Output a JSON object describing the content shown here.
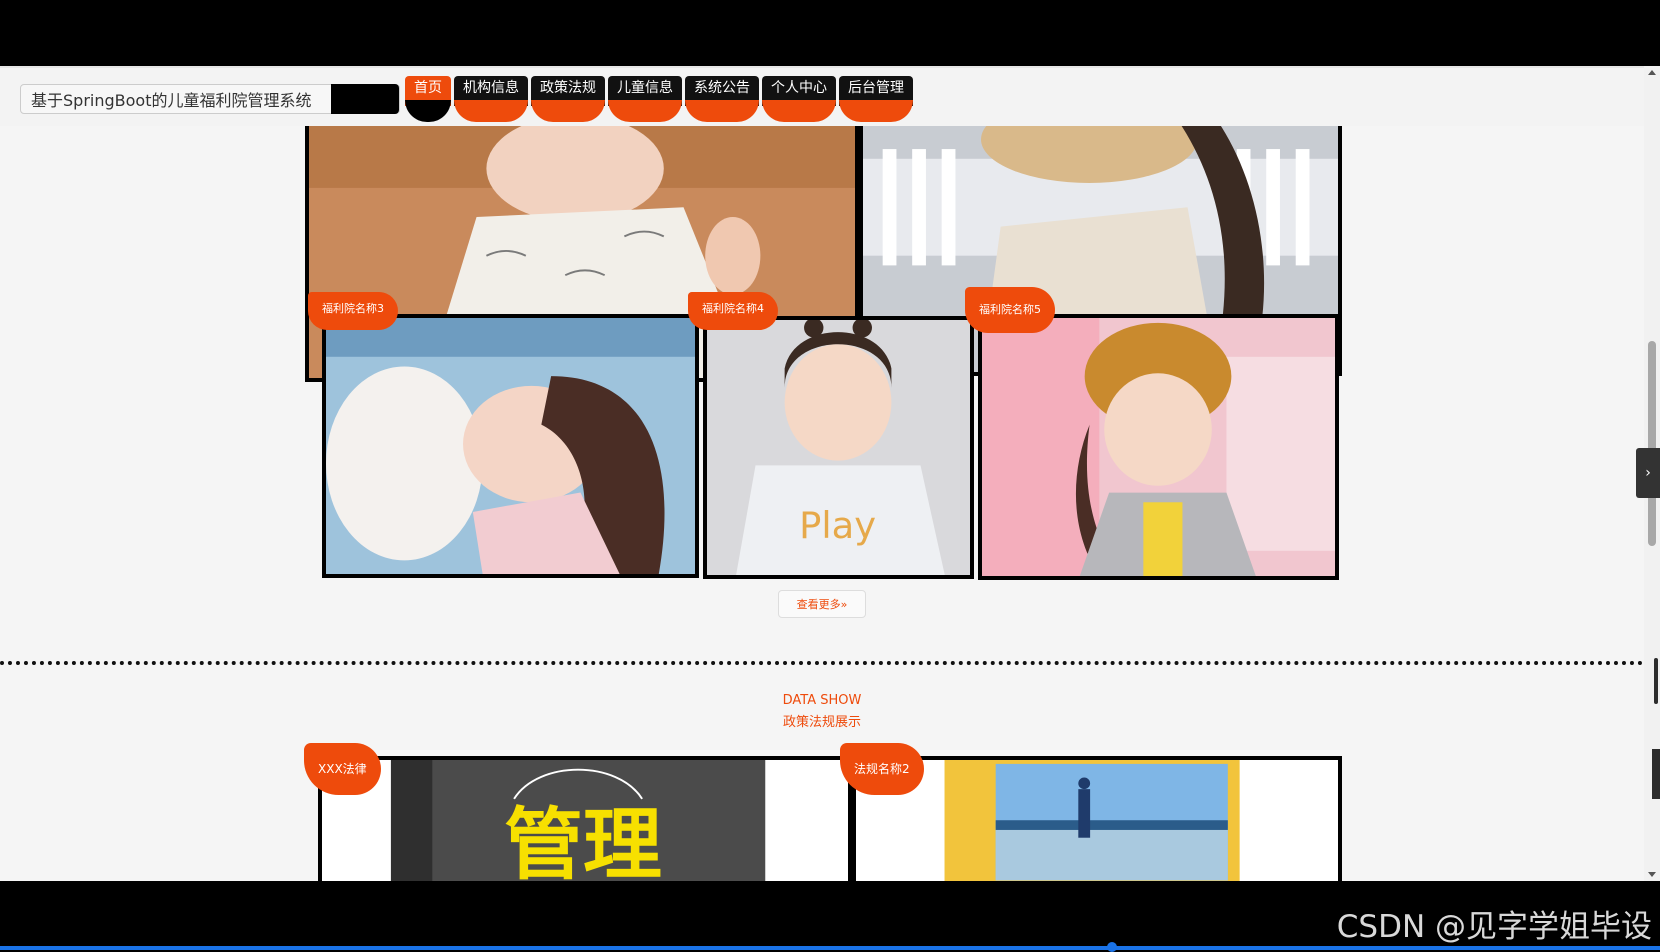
{
  "header": {
    "site_title": "基于SpringBoot的儿童福利院管理系统",
    "nav": [
      {
        "label": "首页",
        "active": true
      },
      {
        "label": "机构信息",
        "active": false
      },
      {
        "label": "政策法规",
        "active": false
      },
      {
        "label": "儿童信息",
        "active": false
      },
      {
        "label": "系统公告",
        "active": false
      },
      {
        "label": "个人中心",
        "active": false
      },
      {
        "label": "后台管理",
        "active": false
      }
    ]
  },
  "orphanages": {
    "items": [
      {
        "name": "福利院名称3"
      },
      {
        "name": "福利院名称4"
      },
      {
        "name": "福利院名称5"
      }
    ],
    "more_label": "查看更多»"
  },
  "data_show": {
    "title_en": "DATA SHOW",
    "title_cn": "政策法规展示",
    "items": [
      {
        "name": "XXX法律"
      },
      {
        "name": "法规名称2"
      }
    ]
  },
  "overlay": {
    "watermark": "CSDN @见字学姐毕设"
  },
  "colors": {
    "accent": "#ee4b0c",
    "nav_bg": "#111111",
    "page_bg": "#f5f5f5"
  }
}
